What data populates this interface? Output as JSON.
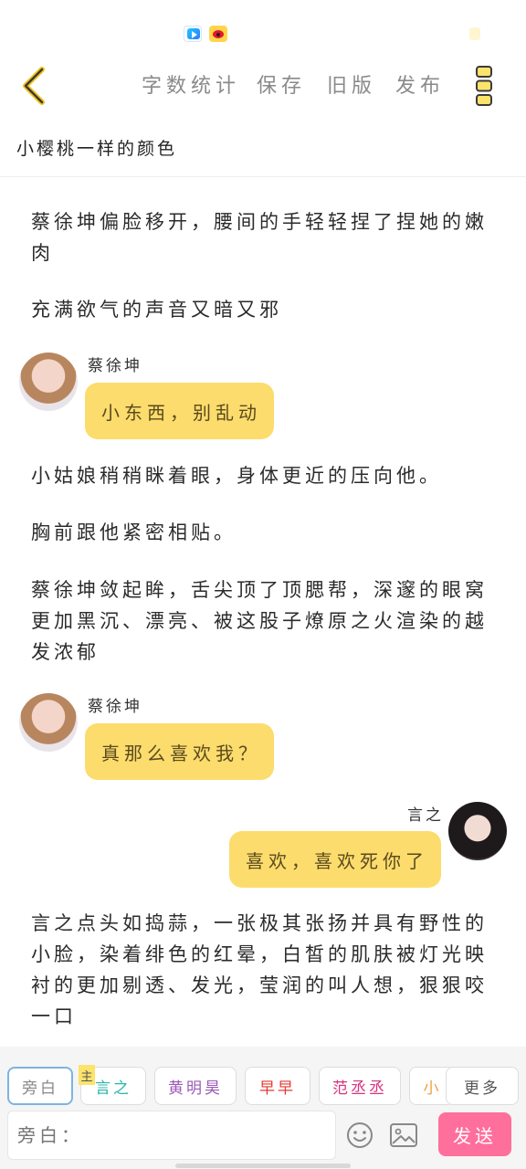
{
  "toolbar": {
    "word_count": "字数统计",
    "save": "保存",
    "old_version": "旧版",
    "publish": "发布"
  },
  "doc_title": "小樱桃一样的颜色",
  "content": {
    "p1": "蔡徐坤偏脸移开，腰间的手轻轻捏了捏她的嫩肉",
    "p2": "充满欲气的声音又暗又邪",
    "dialog1": {
      "speaker": "蔡徐坤",
      "text": "小东西，别乱动"
    },
    "p3": "小姑娘稍稍眯着眼，身体更近的压向他。",
    "p4": "胸前跟他紧密相贴。",
    "p5": "蔡徐坤敛起眸，舌尖顶了顶腮帮，深邃的眼窝更加黑沉、漂亮、被这股子燎原之火渲染的越发浓郁",
    "dialog2": {
      "speaker": "蔡徐坤",
      "text": "真那么喜欢我？"
    },
    "dialog3": {
      "speaker": "言之",
      "text": "喜欢，喜欢死你了"
    },
    "p6": "言之点头如捣蒜，一张极其张扬并具有野性的小脸，染着绯色的红晕，白皙的肌肤被灯光映衬的更加剔透、发光，莹润的叫人想，狠狠咬一口"
  },
  "roles": {
    "narration": "旁白",
    "main_tag": "主",
    "yanzhi": "言之",
    "huangmingyao": "黄明昊",
    "zaozao": "早早",
    "fanchengcheng": "范丞丞",
    "partial": "小",
    "more": "更多"
  },
  "colors": {
    "yanzhi": "#2bb5a8",
    "huangmingyao": "#9b59b6",
    "zaozao": "#e53935",
    "fanchengcheng": "#d8337f",
    "partial": "#f0a040",
    "send": "#ff6f9c",
    "bubble": "#fcdc6d",
    "accent": "#f2c218"
  },
  "composer": {
    "placeholder": "旁白：",
    "send": "发送"
  },
  "icons": {
    "back": "chevron-left-icon",
    "more": "vertical-dots-icon",
    "emoji": "smiley-icon",
    "image": "image-icon"
  }
}
